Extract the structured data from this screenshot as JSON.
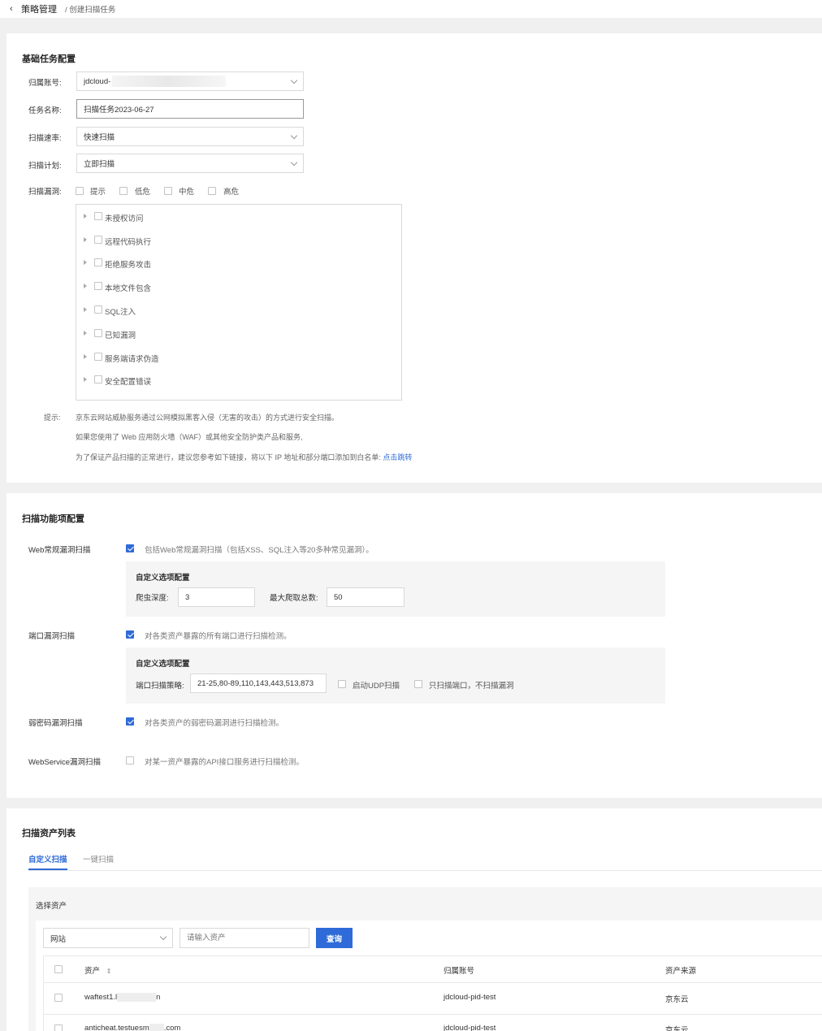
{
  "breadcrumb": {
    "back_icon": "chevron-left-icon",
    "main": "策略管理",
    "sub": "/ 创建扫描任务"
  },
  "basic": {
    "title": "基础任务配置",
    "account_label": "归属账号:",
    "account_value": "jdcloud-",
    "taskname_label": "任务名称:",
    "taskname_value": "扫描任务2023-06-27",
    "rate_label": "扫描速率:",
    "rate_value": "快速扫描",
    "plan_label": "扫描计划:",
    "plan_value": "立即扫描",
    "vuln_label": "扫描漏洞:",
    "levels": [
      "提示",
      "低危",
      "中危",
      "高危"
    ],
    "tree_items": [
      "未授权访问",
      "远程代码执行",
      "拒绝服务攻击",
      "本地文件包含",
      "SQL注入",
      "已知漏洞",
      "服务端请求伪造",
      "安全配置错误"
    ],
    "tip_label": "提示:",
    "tip_lines": [
      "京东云网站威胁服务通过公网模拟黑客入侵（无害的攻击）的方式进行安全扫描。",
      "如果您使用了 Web 应用防火墙（WAF）或其他安全防护类产品和服务,",
      "为了保证产品扫描的正常进行，建议您参考如下链接，将以下 IP 地址和部分端口添加到白名单:"
    ],
    "tip_link": "点击跳转"
  },
  "features": {
    "title": "扫描功能项配置",
    "web_label": "Web常规漏洞扫描",
    "web_desc": "包括Web常规漏洞扫描（包括XSS、SQL注入等20多种常见漏洞）。",
    "custom_title": "自定义选项配置",
    "depth_label": "爬虫深度:",
    "depth_value": "3",
    "max_label": "最大爬取总数:",
    "max_value": "50",
    "port_label": "端口漏洞扫描",
    "port_desc": "对各类资产暴露的所有端口进行扫描检测。",
    "port_custom_title": "自定义选项配置",
    "port_policy_label": "端口扫描策略:",
    "port_policy_value": "21-25,80-89,110,143,443,513,873",
    "udp_label": "启动UDP扫描",
    "only_port_label": "只扫描端口，不扫描漏洞",
    "weak_label": "弱密码漏洞扫描",
    "weak_desc": "对各类资产的弱密码漏洞进行扫描检测。",
    "ws_label": "WebService漏洞扫描",
    "ws_desc": "对某一资产暴露的API接口服务进行扫描检测。"
  },
  "assets": {
    "title": "扫描资产列表",
    "tabs": [
      "自定义扫描",
      "一键扫描"
    ],
    "select_title": "选择资产",
    "type_value": "网站",
    "search_placeholder": "请输入资产",
    "query_label": "查询",
    "columns": [
      "资产",
      "归属账号",
      "资产来源"
    ],
    "sort_icon": "sort-icon",
    "rows": [
      {
        "asset": "waftest1.l",
        "asset_tail": "n",
        "account": "jdcloud-pid-test",
        "source": "京东云"
      },
      {
        "asset": "anticheat.testuesm",
        "asset_tail": ".com",
        "account": "jdcloud-pid-test",
        "source": "京东云"
      }
    ]
  },
  "colors": {
    "accent": "#2f6bd8"
  }
}
